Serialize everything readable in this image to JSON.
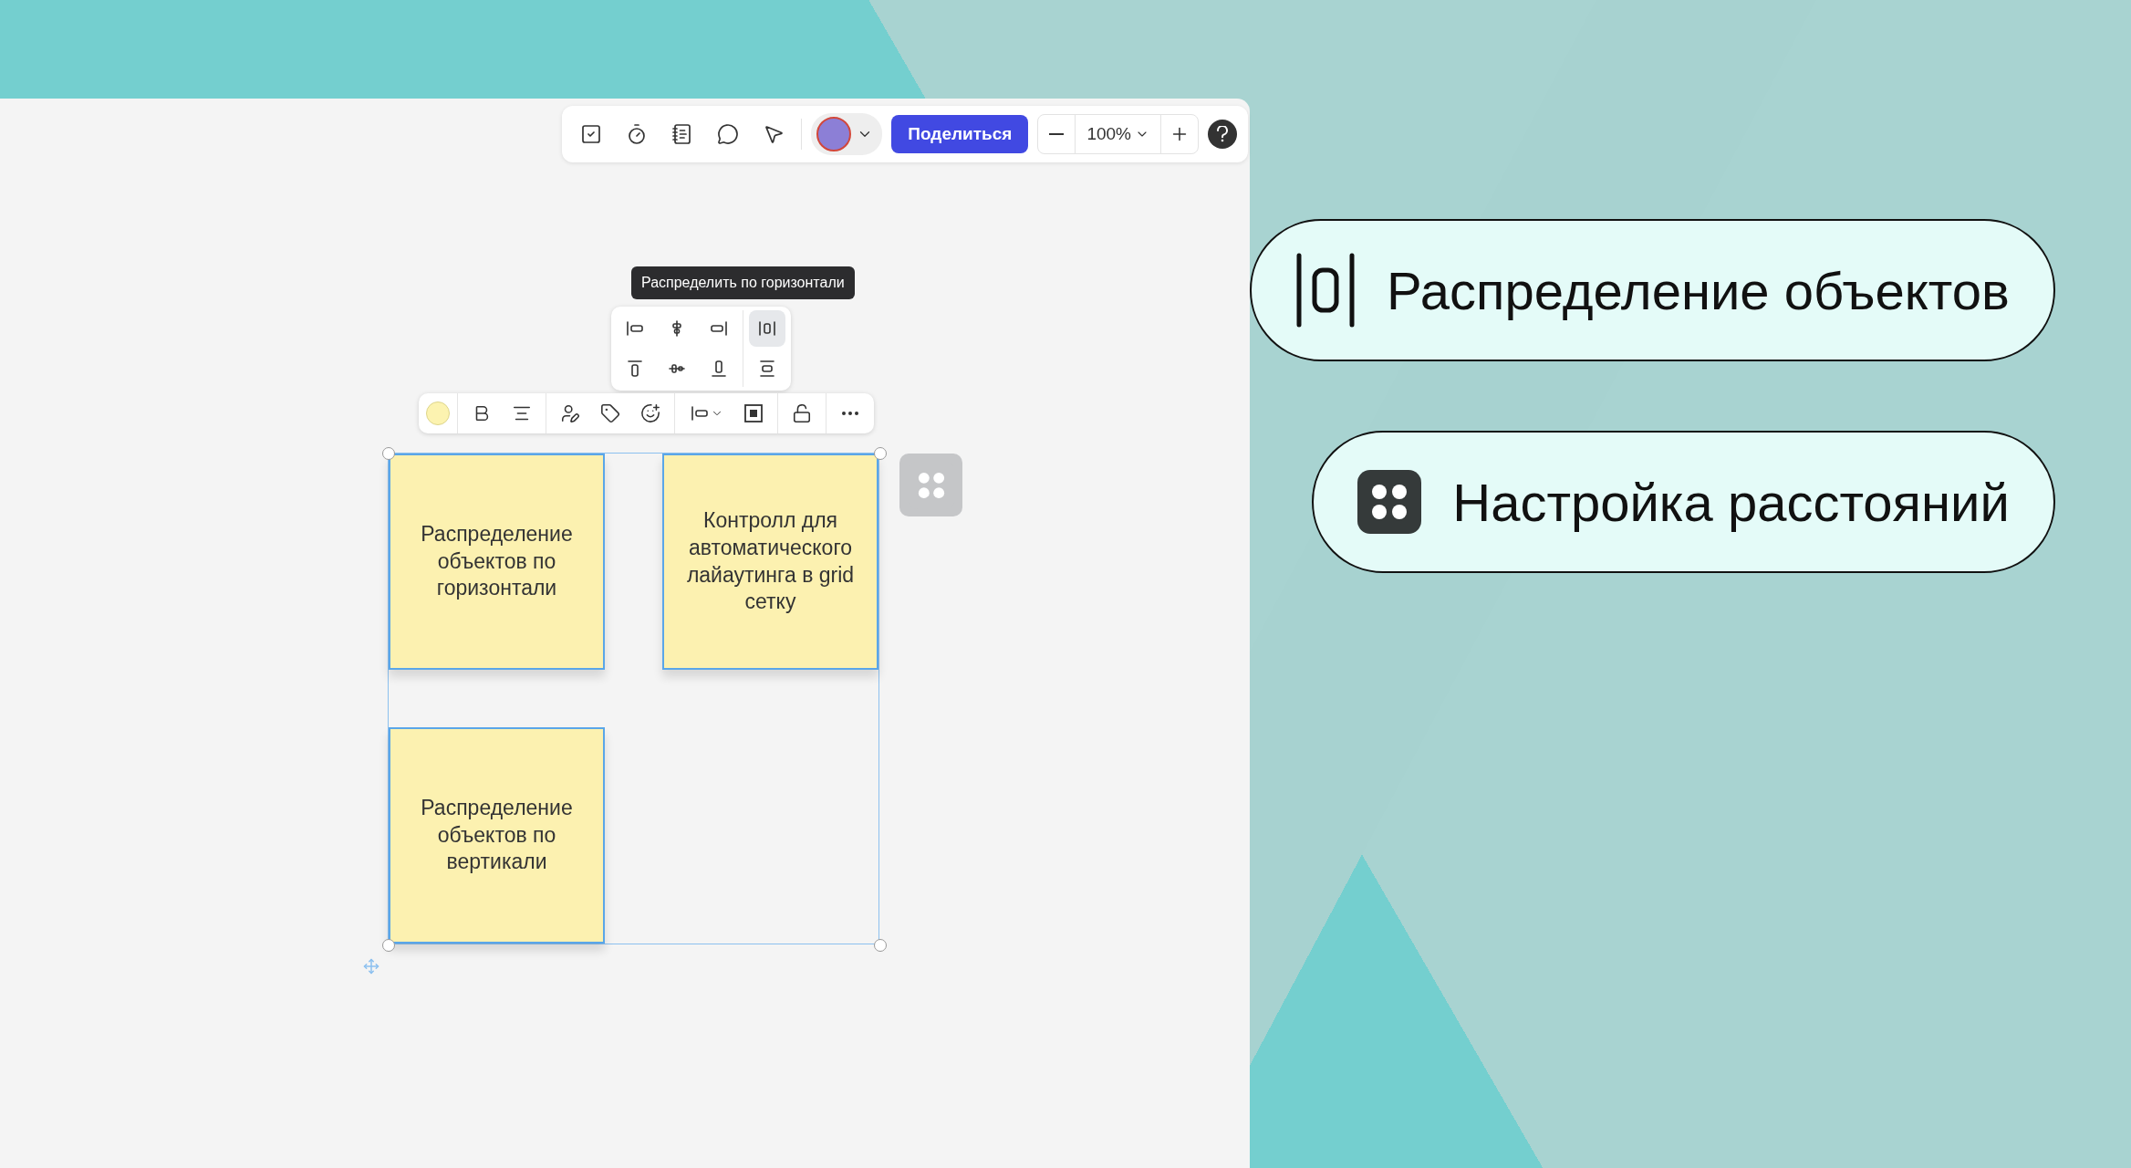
{
  "toolbar": {
    "share_button": "Поделиться",
    "zoom_value": "100%"
  },
  "tooltip": "Распределить по горизонтали",
  "align_menu": [
    {
      "kind": "left",
      "selected": false
    },
    {
      "kind": "center",
      "selected": false
    },
    {
      "kind": "right",
      "selected": false
    },
    {
      "kind": "distribute_h",
      "selected": true
    },
    {
      "kind": "top",
      "selected": false
    },
    {
      "kind": "middle",
      "selected": false
    },
    {
      "kind": "bottom",
      "selected": false
    },
    {
      "kind": "distribute_v",
      "selected": false
    }
  ],
  "notes": [
    {
      "text": "Распределение объектов по горизонтали"
    },
    {
      "text": "Контролл для автоматического лайаутинга в grid сетку"
    },
    {
      "text": "Распределение объектов по вертикали"
    }
  ],
  "features": [
    {
      "kind": "distribute",
      "label": "Распределение объектов"
    },
    {
      "kind": "grid",
      "label": "Настройка расстояний"
    }
  ]
}
